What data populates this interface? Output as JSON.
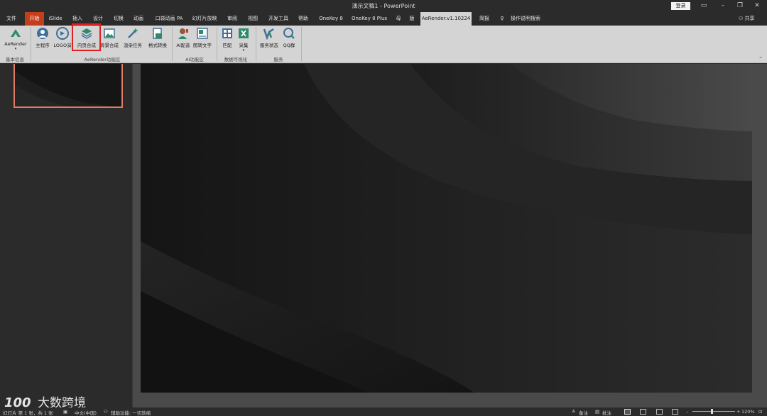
{
  "window": {
    "title": "演示文稿1  -  PowerPoint",
    "login_label": "登录"
  },
  "tabs": {
    "file": "文件",
    "home": "开始",
    "islide": "iSlide",
    "insert": "插入",
    "design": "设计",
    "transitions": "切换",
    "animations": "动画",
    "pocket_animation": "口袋动画 PA",
    "slideshow": "幻灯片放映",
    "review": "审阅",
    "view": "视图",
    "developer": "开发工具",
    "help": "帮助",
    "onekey8": "OneKey 8",
    "onekey8plus": "OneKey 8 Plus",
    "mu": "母",
    "ban": "版",
    "aerender": "AeRender.v1.10224",
    "jianbao": "简报",
    "tell_me": "操作说明搜索",
    "share": "共享"
  },
  "ribbon": {
    "buttons": {
      "aerender": "AeRender",
      "main_program": "主程序",
      "logo_demo": "LOGO演",
      "inner_compose": "内页合成",
      "bg_compose": "背景合成",
      "render_task": "渲染任务",
      "format_convert": "格式转换",
      "ai_dub": "AI配音",
      "voice_text": "图转文字",
      "match": "匹配",
      "collect": "采集",
      "service_status": "服务状态",
      "qq_group": "QQ群"
    },
    "groups": {
      "basic": "基本信息",
      "aerender_area": "AeRender功能区",
      "ai_area": "AI功能区",
      "data_vis": "数据可视化",
      "service": "服务"
    }
  },
  "statusbar": {
    "slide_info": "幻灯片 第 1 张，共 1 张",
    "language": "中文(中国)",
    "accessibility": "辅助功能: 一切就绪",
    "notes": "备注",
    "comments": "批注",
    "zoom": "120%",
    "zoom_level": 0.45
  },
  "watermark": {
    "logo": "100",
    "text": "大数跨境"
  },
  "colors": {
    "home_tab": "#c43e1c",
    "highlight_box": "#e02020",
    "thumb_border": "#e07a64"
  }
}
